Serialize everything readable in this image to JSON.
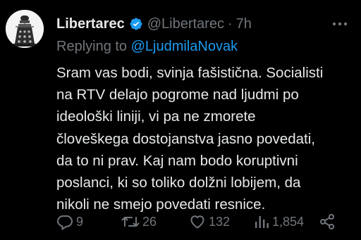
{
  "tweet": {
    "display_name": "Libertarec",
    "handle": "@Libertarec",
    "separator": "·",
    "time": "7h",
    "replying_prefix": "Replying to",
    "replying_to": "@LjudmilaNovak",
    "body_lines": [
      "Sram vas bodi, svinja fašistična. Socialisti",
      "na RTV delajo pogrome nad ljudmi po",
      "ideološki liniji, vi pa ne zmorete",
      "človeškega dostojanstva jasno povedati,",
      "da to ni prav. Kaj nam bodo koruptivni",
      "poslanci, ki so toliko dolžni lobijem, da",
      "nikoli ne smejo povedati resnice."
    ]
  },
  "actions": {
    "replies": "9",
    "retweets": "26",
    "likes": "132",
    "views": "1,854"
  },
  "icons": {
    "avatar": "dalek-avatar",
    "verified": "verified-badge-icon",
    "more": "more-dots-icon",
    "reply": "reply-icon",
    "retweet": "retweet-icon",
    "like": "heart-icon",
    "views": "views-icon",
    "share": "share-icon"
  },
  "colors": {
    "background": "#000000",
    "text": "#e7e9ea",
    "muted": "#71767b",
    "link": "#1d9bf0"
  }
}
